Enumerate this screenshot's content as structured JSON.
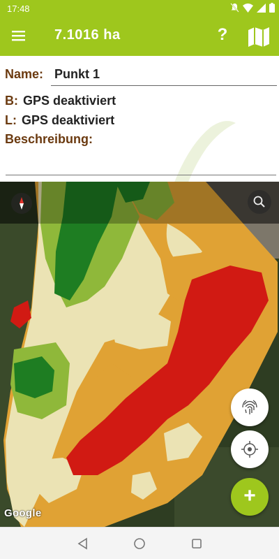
{
  "status_bar": {
    "time": "17:48",
    "icons": [
      "notifications-off-icon",
      "wifi-icon",
      "signal-icon",
      "battery-icon"
    ]
  },
  "app_bar": {
    "title": "7.1016 ha",
    "help_label": "?",
    "menu_icon": "menu-icon",
    "map_icon": "map-icon"
  },
  "form": {
    "name_label": "Name:",
    "name_value": "Punkt 1",
    "latitude_label": "B:",
    "latitude_value": "GPS deaktiviert",
    "longitude_label": "L:",
    "longitude_value": "GPS deaktiviert",
    "description_label": "Beschreibung:",
    "description_value": ""
  },
  "map": {
    "attribution": "Google",
    "compass_icon": "compass-icon",
    "search_icon": "search-icon",
    "zone_colors": {
      "high": "#1e7d22",
      "medium_high": "#8fb83a",
      "medium": "#ebe3b4",
      "medium_low": "#e0a234",
      "low": "#d11a13"
    }
  },
  "fabs": {
    "fingerprint_icon": "fingerprint-icon",
    "location_icon": "gps-target-icon",
    "add_label": "+"
  },
  "nav_bar": {
    "back_icon": "back-triangle-icon",
    "home_icon": "home-circle-icon",
    "recents_icon": "recents-square-icon"
  },
  "colors": {
    "accent": "#9ec71d",
    "label_brown": "#6b3a10"
  }
}
